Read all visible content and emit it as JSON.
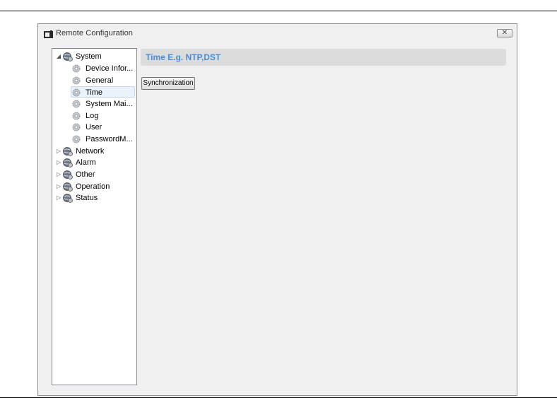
{
  "window": {
    "title": "Remote Configuration",
    "close_label": "✕"
  },
  "tree": {
    "system": {
      "label": "System",
      "expanded_glyph": "◢",
      "children": [
        {
          "label": "Device Infor..."
        },
        {
          "label": "General"
        },
        {
          "label": "Time",
          "selected": true
        },
        {
          "label": "System Mai..."
        },
        {
          "label": "Log"
        },
        {
          "label": "User"
        },
        {
          "label": "PasswordM..."
        }
      ]
    },
    "collapsed_glyph": "▷",
    "groups": [
      {
        "label": "Network"
      },
      {
        "label": "Alarm"
      },
      {
        "label": "Other"
      },
      {
        "label": "Operation"
      },
      {
        "label": "Status"
      }
    ]
  },
  "content": {
    "title": "Time E.g. NTP,DST",
    "sync_button": "Synchronization"
  },
  "colors": {
    "title_accent": "#4a8fd6",
    "selected_row": "#eaf2fb"
  }
}
